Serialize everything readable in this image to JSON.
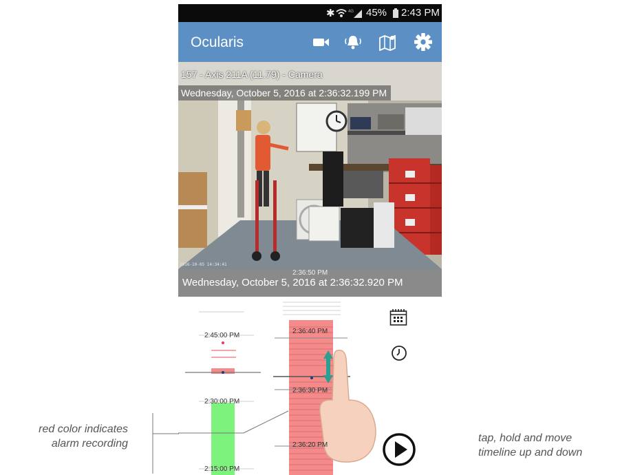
{
  "status_bar": {
    "bluetooth_icon": "bluetooth-icon",
    "wifi_icon": "wifi-icon",
    "signal_icon": "signal-icon",
    "battery_pct": "45%",
    "battery_icon": "battery-icon",
    "time": "2:43 PM"
  },
  "app_bar": {
    "title": "Ocularis",
    "icons": [
      "video-camera-icon",
      "alarm-bell-icon",
      "map-icon",
      "settings-gear-icon"
    ],
    "color": "#5c8fc4"
  },
  "video": {
    "camera_label": "157 - Axis 211A (11.79) - Camera",
    "timestamp": "Wednesday, October 5, 2016 at 2:36:32.199 PM",
    "osd_timestamp": "2016-10-05 14:34:41"
  },
  "playback_bar": {
    "timestamp": "Wednesday, October 5, 2016 at 2:36:32.920 PM",
    "partial_label": "2:36:50 PM"
  },
  "timeline": {
    "coarse_labels": [
      "2:45:00 PM",
      "2:30:00 PM",
      "2:15:00 PM"
    ],
    "fine_labels": [
      "2:36:40 PM",
      "2:36:30 PM",
      "2:36:20 PM"
    ],
    "alarm_color": "#f48a8a",
    "motion_color": "#7df27d",
    "calendar_icon": "calendar-icon",
    "clock_icon": "clock-icon",
    "play_icon": "play-button-icon",
    "gesture": "hand-swipe-icon"
  },
  "annotations": {
    "left_line1": "red color indicates",
    "left_line2": "alarm recording",
    "right_line1": "tap, hold and move",
    "right_line2": "timeline up and down"
  }
}
